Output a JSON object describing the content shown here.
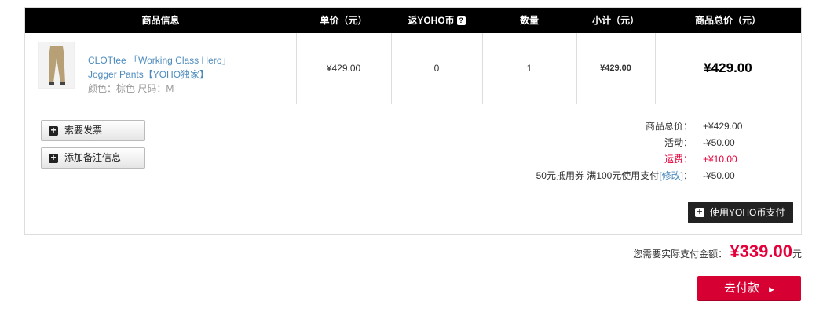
{
  "table": {
    "headers": {
      "product": "商品信息",
      "unit_price": "单价（元）",
      "yoho_coin": "返YOHO币",
      "qty": "数量",
      "subtotal": "小计（元）",
      "total": "商品总价（元）"
    },
    "item": {
      "name_line1": "CLOTtee 「Working Class Hero」",
      "name_line2": "Jogger Pants【YOHO独家】",
      "attrs": "颜色：棕色 尺码：M",
      "unit_price": "¥429.00",
      "yoho_coin": "0",
      "qty": "1",
      "subtotal": "¥429.00",
      "total": "¥429.00"
    }
  },
  "actions": {
    "invoice_label": "索要发票",
    "remark_label": "添加备注信息",
    "yoho_pay_label": "使用YOHO币支付"
  },
  "summary": {
    "goods_label": "商品总价：",
    "goods_value": "+¥429.00",
    "promo_label": "活动：",
    "promo_value": "-¥50.00",
    "shipping_label": "运费：",
    "shipping_value": "+¥10.00",
    "coupon_label": "50元抵用券 满100元使用支付",
    "coupon_link": "[修改]",
    "coupon_sep": "：",
    "coupon_value": "-¥50.00"
  },
  "payable": {
    "label": "您需要实际支付金额：",
    "amount": "¥339.00",
    "unit": "元"
  },
  "checkout_label": "去付款",
  "colors": {
    "accent": "#d70032",
    "price_red": "#e4003a",
    "link": "#4d8bbd"
  }
}
